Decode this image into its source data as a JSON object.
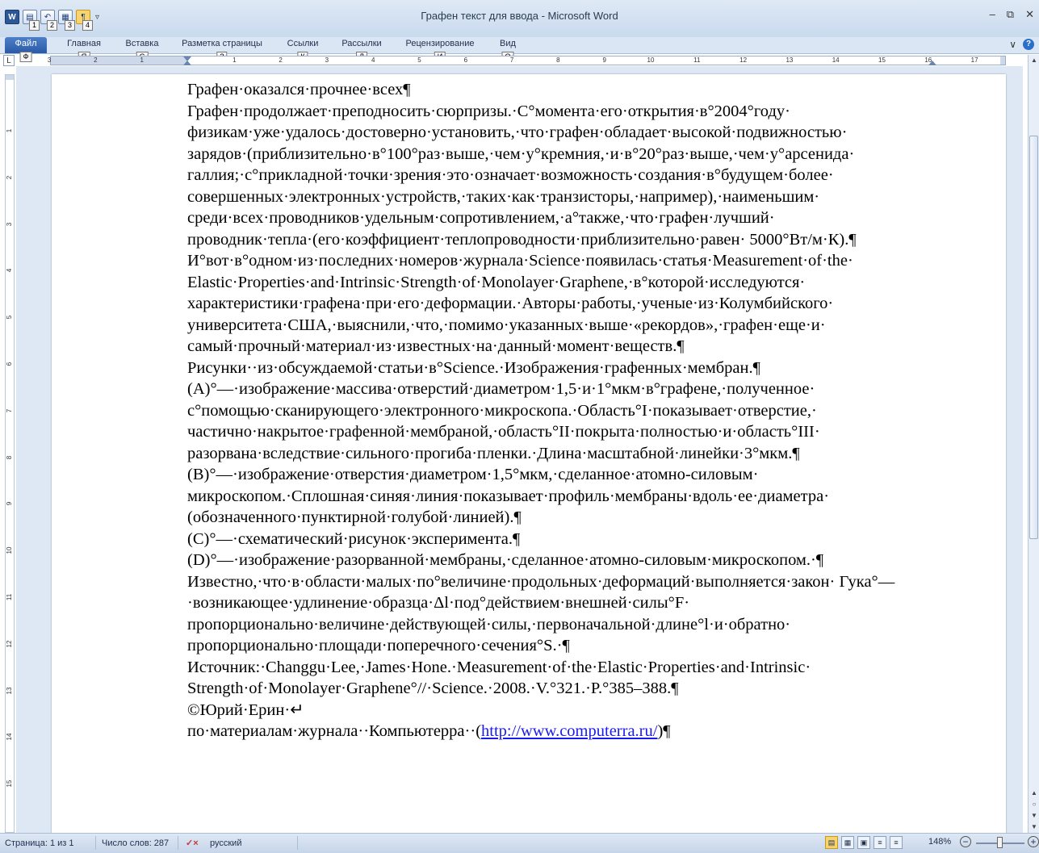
{
  "window": {
    "title": "Графен текст для  ввода - Microsoft Word"
  },
  "qat": {
    "app_icon": "word-app-icon",
    "keytips": [
      "1",
      "2",
      "3",
      "4"
    ],
    "more": "▿"
  },
  "window_controls": {
    "minimize": "–",
    "restore": "⧉",
    "close": "✕"
  },
  "ribbon": {
    "tabs": [
      {
        "label": "Файл",
        "keytip": "Ф"
      },
      {
        "label": "Главная",
        "keytip": "Я"
      },
      {
        "label": "Вставка",
        "keytip": "С"
      },
      {
        "label": "Разметка страницы",
        "keytip": "З"
      },
      {
        "label": "Ссылки",
        "keytip": "К"
      },
      {
        "label": "Рассылки",
        "keytip": "Л"
      },
      {
        "label": "Рецензирование",
        "keytip": "И"
      },
      {
        "label": "Вид",
        "keytip": "О"
      }
    ],
    "collapse": "∨",
    "help": "?"
  },
  "ruler": {
    "corner": "L",
    "numbers": [
      "3",
      "2",
      "1",
      "1",
      "2",
      "3",
      "4",
      "5",
      "6",
      "7",
      "8",
      "9",
      "10",
      "11",
      "12",
      "13",
      "14",
      "15",
      "16",
      "17"
    ],
    "vertical_numbers": [
      "1",
      "2",
      "3",
      "4",
      "5",
      "6",
      "7",
      "8",
      "9",
      "10",
      "11",
      "12",
      "13",
      "14",
      "15"
    ]
  },
  "document": {
    "paragraphs": [
      "Графен·оказался·прочнее·всех¶",
      "Графен·продолжает·преподносить·сюрпризы.·С°момента·его·открытия·в°2004°году· физикам·уже·удалось·достоверно·установить,·что·графен·обладает·высокой·подвижностью· зарядов·(приблизительно·в°100°раз·выше,·чем·у°кремния,·и·в°20°раз·выше,·чем·у°арсенида· галлия;·с°прикладной·точки·зрения·это·означает·возможность·создания·в°будущем·более· совершенных·электронных·устройств,·таких·как·транзисторы,·например),·наименьшим· среди·всех·проводников·удельным·сопротивлением,·а°также,·что·графен·лучший· проводник·тепла·(его·коэффициент·теплопроводности·приблизительно·равен· 5000°Вт/м·К).¶",
      "И°вот·в°одном·из·последних·номеров·журнала·Science·появилась·статья·Measurement·of·the· Elastic·Properties·and·Intrinsic·Strength·of·Monolayer·Graphene,·в°которой·исследуются· характеристики·графена·при·его·деформации.·Авторы·работы,·ученые·из·Колумбийского· университета·США,·выяснили,·что,·помимо·указанных·выше·«рекордов»,·графен·еще·и· самый·прочный·материал·из·известных·на·данный·момент·веществ.¶",
      "Рисунки··из·обсуждаемой·статьи·в°Science.·Изображения·графенных·мембран.¶",
      "(A)°—·изображение·массива·отверстий·диаметром·1,5·и·1°мкм·в°графене,·полученное· с°помощью·сканирующего·электронного·микроскопа.·Область°I·показывает·отверстие,· частично·накрытое·графенной·мембраной,·область°II·покрыта·полностью·и·область°III· разорвана·вследствие·сильного·прогиба·пленки.·Длина·масштабной·линейки·3°мкм.¶",
      "(B)°—·изображение·отверстия·диаметром·1,5°мкм,·сделанное·атомно-силовым· микроскопом.·Сплошная·синяя·линия·показывает·профиль·мембраны·вдоль·ее·диаметра· (обозначенного·пунктирной·голубой·линией).¶",
      "(C)°—·схематический·рисунок·эксперимента.¶",
      "(D)°—·изображение·разорванной·мембраны,·сделанное·атомно-силовым·микроскопом.·¶",
      "Известно,·что·в·области·малых·по°величине·продольных·деформаций·выполняется·закон· Гука°—·возникающее·удлинение·образца·Δl·под°действием·внешней·силы°F· пропорционально·величине·действующей·силы,·первоначальной·длине°l·и·обратно· пропорционально·площади·поперечного·сечения°S.·¶",
      "Источник:·Changgu·Lee,·James·Hone.·Measurement·of·the·Elastic·Properties·and·Intrinsic· Strength·of·Monolayer·Graphene°//·Science.·2008.·V.°321.·P.°385–388.¶",
      "©Юрий·Ерин·↵"
    ],
    "last_line_prefix": "по·материалам·журнала··Компьютерра··(",
    "last_line_link": "http://www.computerra.ru/",
    "last_line_suffix": ")¶"
  },
  "statusbar": {
    "page": "Страница: 1 из 1",
    "words": "Число слов: 287",
    "language": "русский",
    "zoom": "148%",
    "zoom_minus": "−",
    "zoom_plus": "+"
  }
}
